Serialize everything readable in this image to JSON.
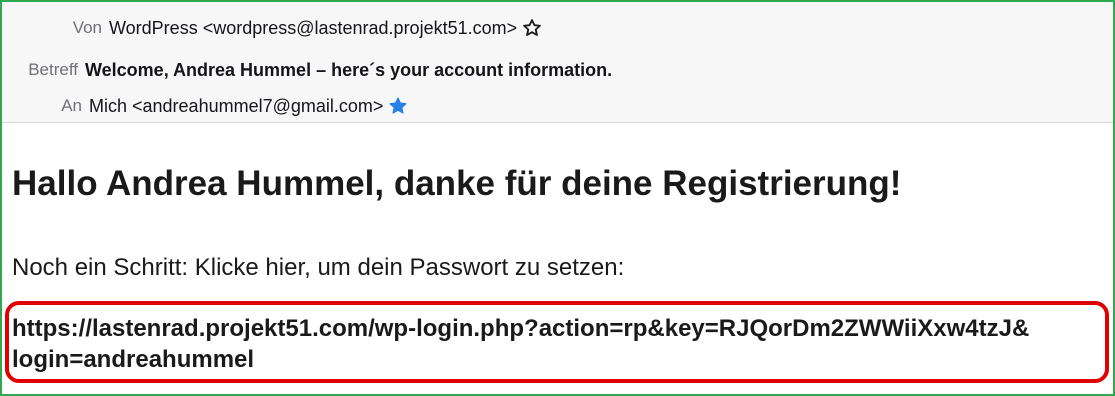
{
  "header": {
    "from_label": "Von",
    "from_value": "WordPress <wordpress@lastenrad.projekt51.com>",
    "subject_label": "Betreff",
    "subject_value": "Welcome, Andrea Hummel – here´s your account information.",
    "to_label": "An",
    "to_value": "Mich <andreahummel7@gmail.com>",
    "from_star_icon": "star-outline-icon",
    "to_star_icon": "star-filled-icon",
    "star_color": "#2a7fe6"
  },
  "body": {
    "greeting": "Hallo Andrea Hummel, danke für deine Registrierung!",
    "step_text": "Noch ein Schritt: Klicke hier, um dein Passwort zu setzen:",
    "link_line1": "https://lastenrad.projekt51.com/wp-login.php?action=rp&key=RJQorDm2ZWWiiXxw4tzJ&",
    "link_line2": "login=andreahummel"
  },
  "colors": {
    "frame_border": "#2fa84f",
    "highlight_box": "#e00000"
  }
}
